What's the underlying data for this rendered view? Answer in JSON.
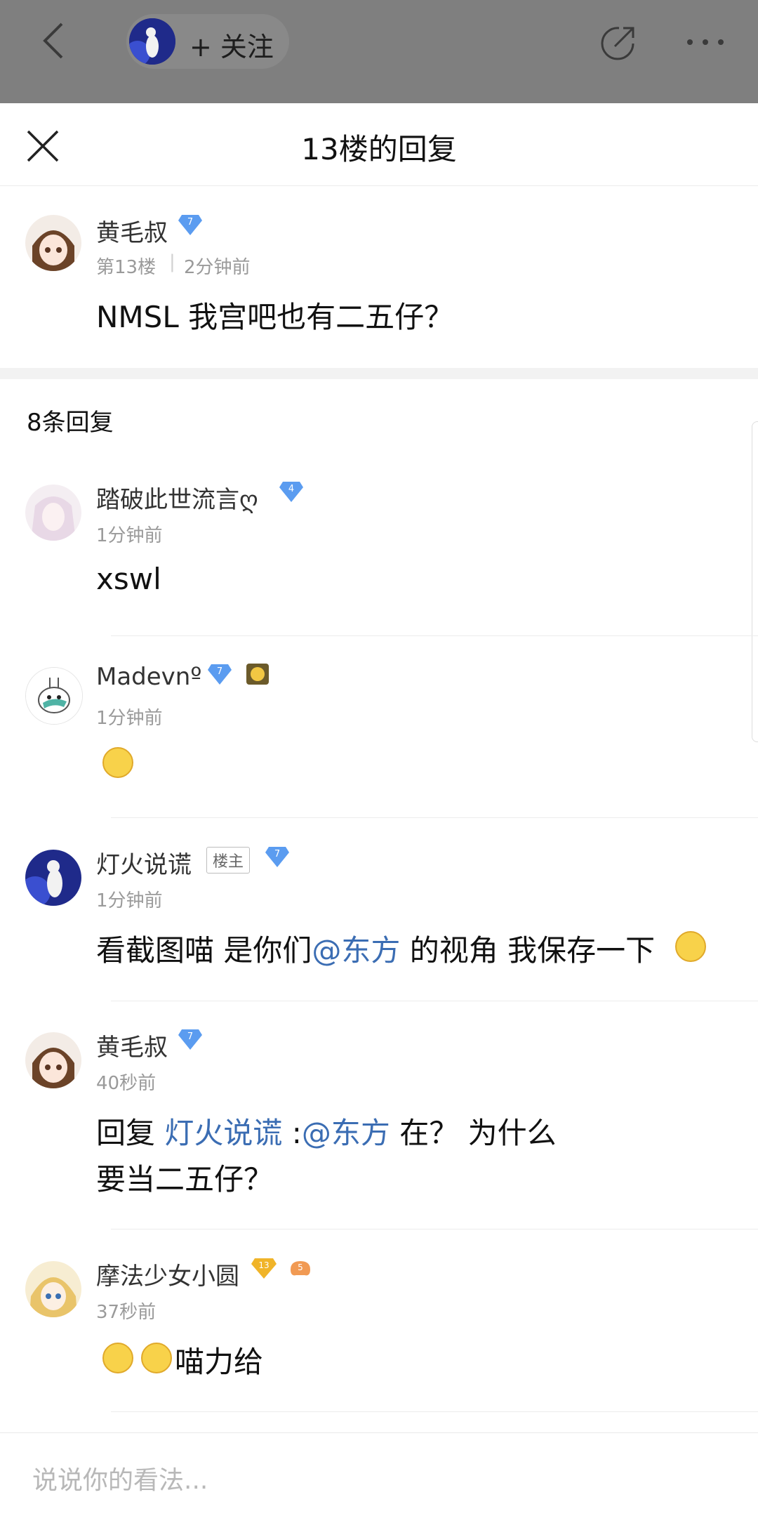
{
  "topbar": {
    "follow_label": "+ 关注"
  },
  "sheet": {
    "title": "13楼的回复"
  },
  "main_post": {
    "username": "黄毛叔",
    "level": "7",
    "floor": "第13楼",
    "time": "2分钟前",
    "content": "NMSL 我宫吧也有二五仔？"
  },
  "reply_count": "8条回复",
  "replies": [
    {
      "username": "踏破此世流言ღ",
      "level": "4",
      "time": "1分钟前",
      "content": "xswl"
    },
    {
      "username": "Madevnº",
      "level": "7",
      "time": "1分钟前",
      "content": ""
    },
    {
      "username": "灯火说谎",
      "tag": "楼主",
      "level": "7",
      "time": "1分钟前",
      "content_pre": "看截图喵 是你们",
      "content_link": "@东方",
      "content_post": " 的视角 我保存一下"
    },
    {
      "username": "黄毛叔",
      "level": "7",
      "time": "40秒前",
      "reply_prefix": "回复 ",
      "reply_target": "灯火说谎",
      "reply_colon": " :",
      "content_link": "@东方",
      "content_post": " 在？ 为什么",
      "content_line2": "要当二五仔？"
    },
    {
      "username": "摩法少女小圆",
      "level": "13",
      "level2": "5",
      "time": "37秒前",
      "content": "喵力给"
    }
  ],
  "input": {
    "placeholder": "说说你的看法..."
  },
  "colors": {
    "topbar_bg": "#7f7f7f",
    "link": "#3b6db3",
    "level_badge": "#5b9cf0",
    "gold_badge": "#f0b429"
  }
}
